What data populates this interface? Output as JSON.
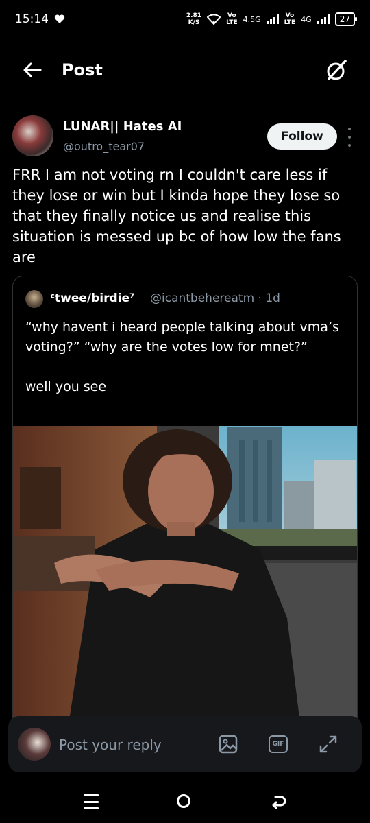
{
  "status_bar": {
    "time": "15:14",
    "speed_value": "2.81",
    "speed_unit": "K/S",
    "net1_top": "Vo",
    "net1_bottom": "LTE",
    "net1_type": "4.5G",
    "net2_top": "Vo",
    "net2_bottom": "LTE",
    "net2_type": "4G",
    "battery": "27"
  },
  "header": {
    "title": "Post"
  },
  "post": {
    "display_name": "LUNAR|| Hates AI",
    "handle": "@outro_tear07",
    "follow_label": "Follow",
    "text": "FRR I am not voting rn I couldn't care less if they lose or win but I kinda hope they lose so that they finally notice us and realise this situation is messed up bc of how low the fans are"
  },
  "quote": {
    "display_name": "ᶜtwee/birdie⁷",
    "handle_time": "@icantbehereatm · 1d",
    "text": "“why havent i heard people talking about vma’s voting?” “why are the votes low for mnet?”\n\nwell you see"
  },
  "reply": {
    "placeholder": "Post your reply",
    "gif_label": "GIF"
  },
  "icons": {
    "back": "arrow-left-icon",
    "grok": "grok-icon",
    "more": "more-vertical-icon",
    "media": "image-icon",
    "gif": "gif-icon",
    "expand": "expand-icon",
    "nav_menu": "recents-icon",
    "nav_home": "home-circle-icon",
    "nav_back": "back-gesture-icon"
  },
  "colors": {
    "background": "#000000",
    "text_primary": "#e7e9ea",
    "text_secondary": "#8b98a5",
    "border": "#2f3336",
    "reply_bg": "#16181c",
    "follow_bg": "#eff3f4"
  }
}
